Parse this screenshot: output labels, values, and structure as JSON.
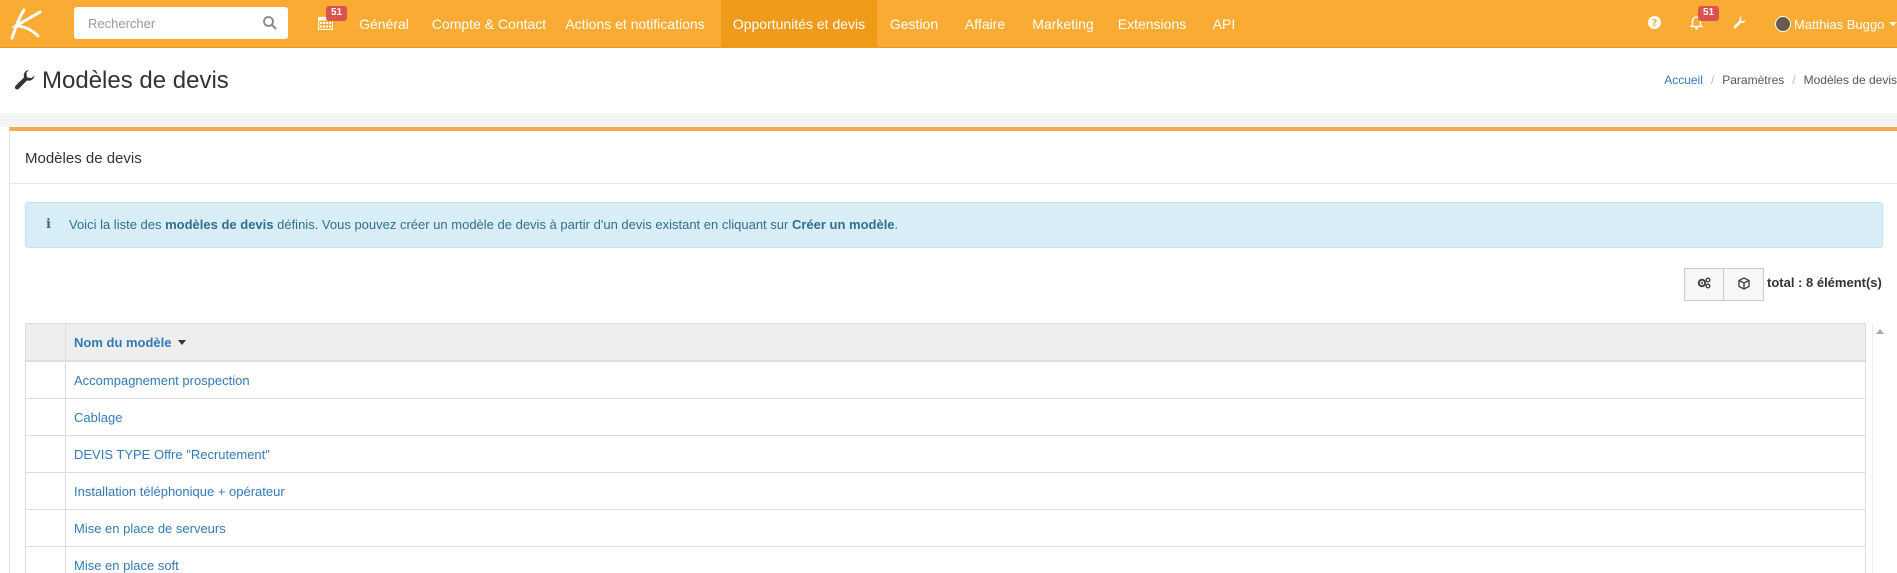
{
  "search": {
    "placeholder": "Rechercher"
  },
  "header": {
    "calendar_badge": "51",
    "nav": [
      {
        "label": "Général"
      },
      {
        "label": "Compte & Contact"
      },
      {
        "label": "Actions et notifications"
      },
      {
        "label": "Opportunités et devis",
        "active": true
      },
      {
        "label": "Gestion"
      },
      {
        "label": "Affaire"
      },
      {
        "label": "Marketing"
      },
      {
        "label": "Extensions"
      },
      {
        "label": "API"
      }
    ],
    "notification_badge": "51",
    "user_name": "Matthias Buggo",
    "accent_color": "#f9ab33"
  },
  "page": {
    "title": "Modèles de devis",
    "breadcrumb": [
      "Accueil",
      "Paramètres",
      "Modèles de devis"
    ]
  },
  "panel": {
    "heading": "Modèles de devis",
    "info": {
      "part1": "Voici la liste des ",
      "bold1": "modèles de devis",
      "part2": " définis. Vous pouvez créer un modèle de devis à partir d'un devis existant en cliquant sur ",
      "bold2": "Créer un modèle",
      "part3": "."
    },
    "total": "total : 8 élément(s)"
  },
  "table": {
    "column_header": "Nom du modèle",
    "rows": [
      "Accompagnement prospection",
      "Cablage",
      "DEVIS TYPE Offre \"Recrutement\"",
      "Installation téléphonique + opérateur",
      "Mise en place de serveurs",
      "Mise en place soft"
    ]
  }
}
